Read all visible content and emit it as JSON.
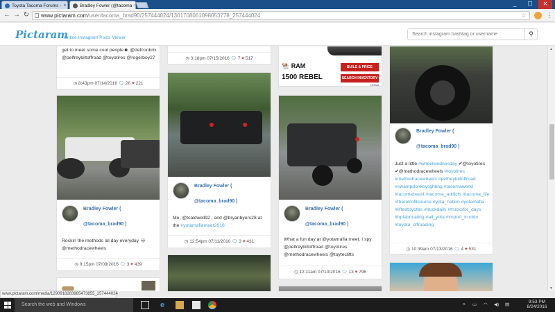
{
  "browser": {
    "tabs": [
      {
        "title": "Toyota Tacoma Forums -"
      },
      {
        "title": "Bradley Fowler (@tacoma"
      }
    ],
    "url_host": "www.pictaram.com",
    "url_path": "/user/tacoma_brad90/257444024/1301708061098053778_257444024",
    "window_controls": [
      "_",
      "☐",
      "✕"
    ]
  },
  "site": {
    "logo": "Pictaram",
    "tagline": "Online Instagram Posts Viewer",
    "search_placeholder": "Search instagram hashtag or username"
  },
  "posts": {
    "c1_top": {
      "caption_prefix": "get to meet some cool people☻ @defconbrix @pelfreybiltoffroad @toyotires @rogerboy27",
      "time": "8:43pm 07/14/2016",
      "comments": "26",
      "likes": "221"
    },
    "c2_top": {
      "time": "3:18pm 07/15/2016",
      "comments": "7",
      "likes": "517"
    },
    "c3_top": {
      "ad_brand": "RAM",
      "ad_model": "1500 REBEL",
      "ad_btn1": "BUILD & PRICE",
      "ad_btn2": "SEARCH INVENTORY",
      "ad_legal": "LEGAL"
    },
    "c1_mid": {
      "name": "Bradley Fowler (",
      "handle": "@tacoma_brad90 )",
      "caption_text": "Rockin the methods all day everyday 💀 @methodracewheels",
      "time": "9:15pm 07/09/2016",
      "comments": "3",
      "likes": "439"
    },
    "c2_mid": {
      "name": "Bradley Fowler (",
      "handle": "@tacoma_brad90 )",
      "caption_text": "Me, @tcaldwell92 , and @bryanbyers28 at the",
      "caption_tag": "#yotamafiameet2016",
      "time": "12:54pm 07/11/2016",
      "comments": "3",
      "likes": "431"
    },
    "c3_mid": {
      "name": "Bradley Fowler (",
      "handle": "@tacoma_brad90 )",
      "caption_text": "What a fun day at @yotamafia meet. I spy @pelfreybiltoffroad @toyotires @methodracewheels @toyteclifts",
      "time": "12:11am 07/10/2016",
      "comments": "13",
      "likes": "796"
    },
    "c4_mid": {
      "name": "Bradley Fowler (",
      "handle": "@tacoma_brad90 )",
      "caption_lead": "Just a little",
      "tag_wheelwednesday": "#wheelwednesday",
      "caption_mid": "✔@toyotires ✔@methodracewheels",
      "tags": [
        "#toyotires",
        "#methodracewheels",
        "#pelfreybiltoffroad",
        "#swampdonkeylighting",
        "#tacomaworld",
        "#tacomabeast",
        "#tacoma_addicts",
        "#tacoma_life",
        "#theretrofitsource",
        "#yota_nation",
        "#yotamafia",
        "#liftedtoyotas",
        "#truckdaily",
        "#trucksfor_days",
        "#bpfabricating",
        "#all_yota",
        "#import_truckin",
        "#toyota_offroading"
      ],
      "time": "10:39am 07/13/2016",
      "comments": "4",
      "likes": "531"
    }
  },
  "status_url": "www.pictaram.com/media/1290918283985473855_257444024",
  "taskbar": {
    "search_text": "Search the web and Windows",
    "time": "9:53 PM",
    "date": "8/24/2016"
  },
  "colors": {
    "accent": "#3a9ad9",
    "link": "#3a70b0",
    "heart": "#e24040"
  }
}
